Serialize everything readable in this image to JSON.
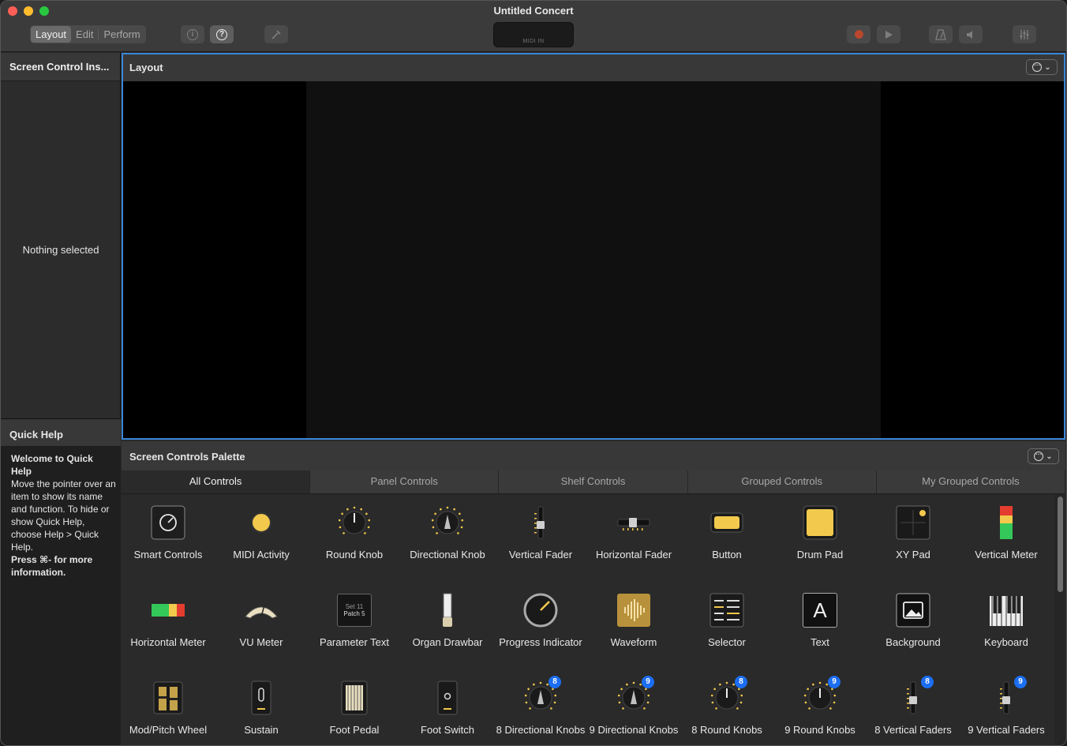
{
  "window": {
    "title": "Untitled Concert"
  },
  "toolbar": {
    "modes": [
      "Layout",
      "Edit",
      "Perform"
    ],
    "active_mode": "Layout",
    "lcd_label": "MIDI IN",
    "icons": [
      "info-icon",
      "help-icon",
      "tuner-icon",
      "record-icon",
      "play-icon",
      "metronome-icon",
      "speaker-icon",
      "mixer-icon"
    ]
  },
  "inspector": {
    "title": "Screen Control Ins...",
    "empty_text": "Nothing selected"
  },
  "quick_help": {
    "title": "Quick Help",
    "heading": "Welcome to Quick Help",
    "body": "Move the pointer over an item to show its name and function. To hide or show Quick Help, choose Help > Quick Help.",
    "footer": "Press ⌘- for more information."
  },
  "layout": {
    "title": "Layout"
  },
  "palette": {
    "title": "Screen Controls Palette",
    "tabs": [
      "All Controls",
      "Panel Controls",
      "Shelf Controls",
      "Grouped Controls",
      "My Grouped Controls"
    ],
    "active_tab": "All Controls",
    "items": [
      {
        "label": "Smart Controls",
        "icon": "smart-controls-icon"
      },
      {
        "label": "MIDI Activity",
        "icon": "midi-activity-icon"
      },
      {
        "label": "Round Knob",
        "icon": "round-knob-icon"
      },
      {
        "label": "Directional Knob",
        "icon": "directional-knob-icon"
      },
      {
        "label": "Vertical Fader",
        "icon": "vertical-fader-icon"
      },
      {
        "label": "Horizontal Fader",
        "icon": "horizontal-fader-icon"
      },
      {
        "label": "Button",
        "icon": "button-icon"
      },
      {
        "label": "Drum Pad",
        "icon": "drum-pad-icon"
      },
      {
        "label": "XY Pad",
        "icon": "xy-pad-icon"
      },
      {
        "label": "Vertical Meter",
        "icon": "vertical-meter-icon"
      },
      {
        "label": "Horizontal Meter",
        "icon": "horizontal-meter-icon"
      },
      {
        "label": "VU Meter",
        "icon": "vu-meter-icon"
      },
      {
        "label": "Parameter Text",
        "icon": "parameter-text-icon",
        "icon_text": [
          "Set 11",
          "Patch 5"
        ]
      },
      {
        "label": "Organ Drawbar",
        "icon": "organ-drawbar-icon"
      },
      {
        "label": "Progress Indicator",
        "icon": "progress-indicator-icon"
      },
      {
        "label": "Waveform",
        "icon": "waveform-icon"
      },
      {
        "label": "Selector",
        "icon": "selector-icon"
      },
      {
        "label": "Text",
        "icon": "text-icon",
        "icon_text": "A"
      },
      {
        "label": "Background",
        "icon": "background-icon"
      },
      {
        "label": "Keyboard",
        "icon": "keyboard-icon"
      },
      {
        "label": "Mod/Pitch Wheel",
        "icon": "mod-pitch-wheel-icon"
      },
      {
        "label": "Sustain",
        "icon": "sustain-icon"
      },
      {
        "label": "Foot Pedal",
        "icon": "foot-pedal-icon"
      },
      {
        "label": "Foot Switch",
        "icon": "foot-switch-icon"
      },
      {
        "label": "8 Directional Knobs",
        "icon": "directional-knob-icon",
        "badge": "8"
      },
      {
        "label": "9 Directional Knobs",
        "icon": "directional-knob-icon",
        "badge": "9"
      },
      {
        "label": "8 Round Knobs",
        "icon": "round-knob-icon",
        "badge": "8"
      },
      {
        "label": "9 Round Knobs",
        "icon": "round-knob-icon",
        "badge": "9"
      },
      {
        "label": "8 Vertical Faders",
        "icon": "vertical-fader-icon",
        "badge": "8"
      },
      {
        "label": "9 Vertical Faders",
        "icon": "vertical-fader-icon",
        "badge": "9"
      }
    ]
  },
  "colors": {
    "accent": "#3b86d9",
    "knob_yellow": "#f2c94c",
    "badge_blue": "#1c6ef2"
  }
}
